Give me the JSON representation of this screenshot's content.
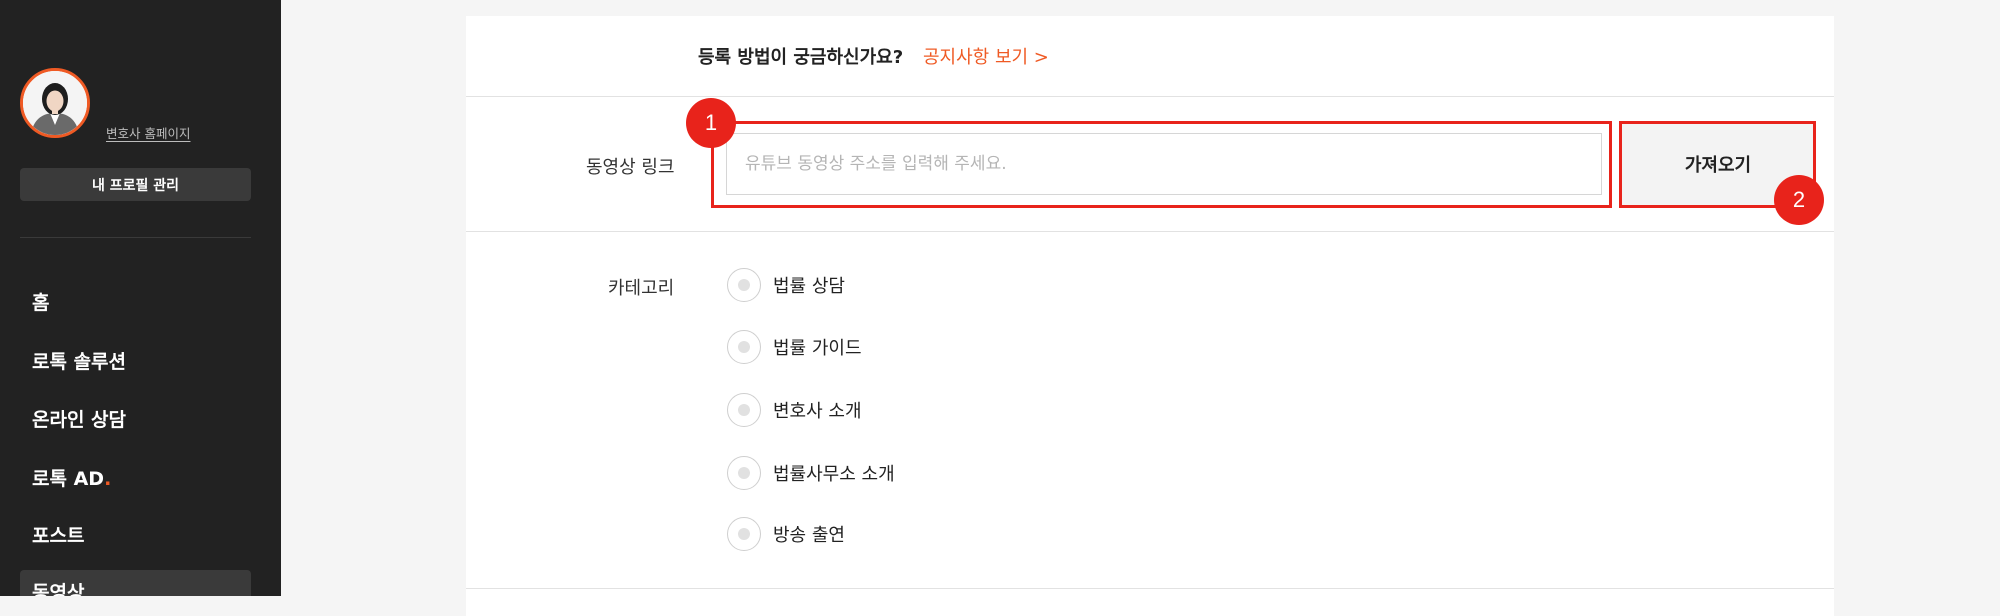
{
  "sidebar": {
    "homepage_link": "변호사 홈페이지",
    "profile_button": "내 프로필 관리",
    "nav": [
      {
        "label": "홈"
      },
      {
        "label": "로톡 솔루션"
      },
      {
        "label": "온라인 상담"
      },
      {
        "label": "로톡 AD",
        "dot": "."
      },
      {
        "label": "포스트"
      },
      {
        "label": "동영상"
      }
    ]
  },
  "notice": {
    "question": "등록 방법이 궁금하신가요?",
    "link": "공지사항 보기 >"
  },
  "video_link": {
    "label": "동영상 링크",
    "placeholder": "유튜브 동영상 주소를 입력해 주세요.",
    "value": "",
    "fetch_button": "가져오기"
  },
  "category": {
    "label": "카테고리",
    "options": [
      "법률 상담",
      "법률 가이드",
      "변호사 소개",
      "법률사무소 소개",
      "방송 출연"
    ]
  },
  "annotations": {
    "badge1": "1",
    "badge2": "2"
  },
  "colors": {
    "accent": "#ef5a24",
    "highlight": "#e8231b",
    "sidebar_bg": "#222222"
  }
}
